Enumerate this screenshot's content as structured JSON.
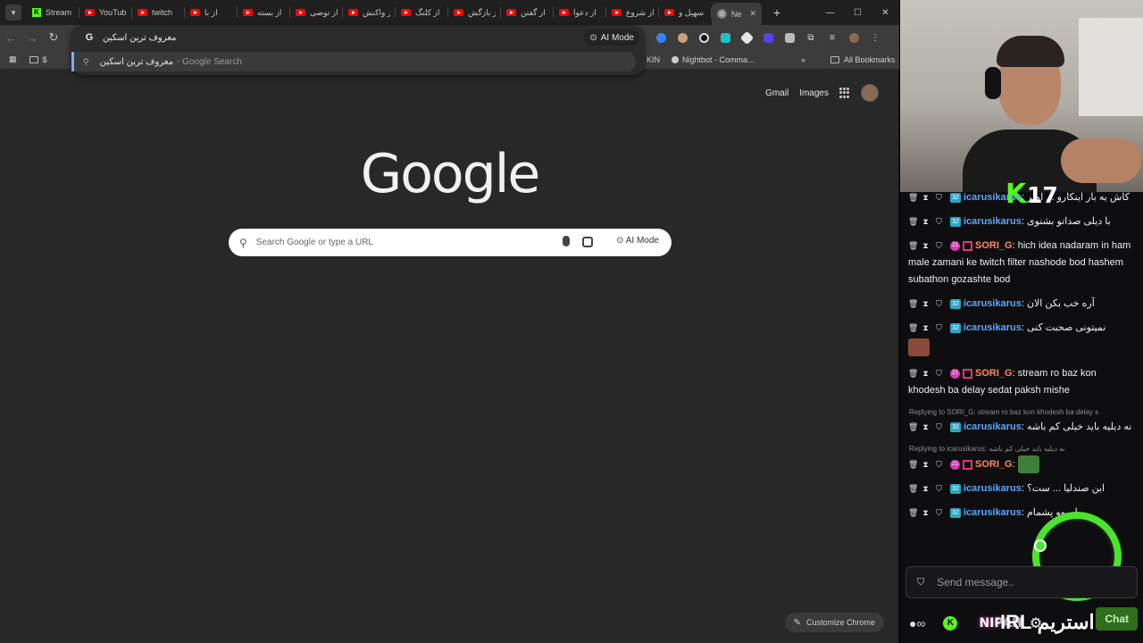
{
  "browser": {
    "tabs": [
      {
        "title": "Stream",
        "favicon": "kick-icon",
        "active": false
      },
      {
        "title": "YouTub",
        "favicon": "youtube-icon",
        "active": false
      },
      {
        "title": "twitch",
        "favicon": "youtube-icon",
        "active": false
      },
      {
        "title": "از با",
        "favicon": "youtube-icon",
        "active": false
      },
      {
        "title": "از بسته",
        "favicon": "youtube-icon",
        "active": false
      },
      {
        "title": "از توضی",
        "favicon": "youtube-icon",
        "active": false
      },
      {
        "title": "از واکنش",
        "favicon": "youtube-icon",
        "active": false
      },
      {
        "title": "از کلنگ",
        "favicon": "youtube-icon",
        "active": false
      },
      {
        "title": "از بازگش",
        "favicon": "youtube-icon",
        "active": false
      },
      {
        "title": "از گفتن",
        "favicon": "youtube-icon",
        "active": false
      },
      {
        "title": "از دعوا",
        "favicon": "youtube-icon",
        "active": false
      },
      {
        "title": "از شروع",
        "favicon": "youtube-icon",
        "active": false
      },
      {
        "title": "سهیل و",
        "favicon": "youtube-icon",
        "active": false
      },
      {
        "title": "Ne",
        "favicon": "chrome-icon",
        "active": true
      }
    ],
    "omnibox": {
      "value": "معروف ترین اسکین",
      "ai_mode_label": "AI Mode",
      "suggestion_text": "معروف ترین اسکین",
      "suggestion_sub": "- Google Search"
    },
    "bookmarks": [
      {
        "label": "$"
      },
      {
        "label": "KIN"
      },
      {
        "label": "Nightbot - Comma..."
      }
    ],
    "bookmarks_overflow": "»",
    "all_bookmarks_label": "All Bookmarks",
    "ntp": {
      "gmail_label": "Gmail",
      "images_label": "Images",
      "logo_text": "Google",
      "search_placeholder": "Search Google or type a URL",
      "ai_mode_label": "AI Mode",
      "customize_label": "Customize Chrome"
    },
    "accent_color": "#7cacf8"
  },
  "stream": {
    "kick_badge_letter": "K",
    "kick_badge_number": "17",
    "chat": [
      {
        "type": "msg",
        "user": "icarusikarus",
        "badges": [
          "32"
        ],
        "text": "کاش یه بار اینکارو ... امیر"
      },
      {
        "type": "msg",
        "user": "icarusikarus",
        "badges": [
          "32"
        ],
        "text": "با دیلی صداتو بشنوی"
      },
      {
        "type": "msg",
        "user": "SORI_G",
        "badges": [
          "21",
          "n"
        ],
        "text": "hich idea nadaram in ham male zamani ke twitch filter nashode bod hashem subathon gozashte bod"
      },
      {
        "type": "msg",
        "user": "icarusikarus",
        "badges": [
          "32"
        ],
        "text": "آره خب بکن الان"
      },
      {
        "type": "msg",
        "user": "icarusikarus",
        "badges": [
          "32"
        ],
        "text": "نمیتونی صحبت کنی"
      },
      {
        "type": "msg",
        "user": "SORI_G",
        "badges": [
          "21",
          "n"
        ],
        "text": "stream ro baz kon khodesh ba delay sedat paksh mishe"
      },
      {
        "type": "reply",
        "text": "Replying to SORI_G: stream ro baz kon khodesh ba delay s"
      },
      {
        "type": "msg",
        "user": "icarusikarus",
        "badges": [
          "32"
        ],
        "text": "نه دیلیه باید خیلی کم باشه"
      },
      {
        "type": "reply",
        "text": "Replying to icarusikarus: نه دیلیه باید خیلی کم باشه"
      },
      {
        "type": "msg",
        "user": "SORI_G",
        "badges": [
          "21",
          "n"
        ],
        "text": ""
      },
      {
        "type": "msg",
        "user": "icarusikarus",
        "badges": [
          "32"
        ],
        "text": "این صندلیا ... ست؟"
      },
      {
        "type": "msg",
        "user": "icarusikarus",
        "badges": [
          "32"
        ],
        "text": "اوروو پشمام"
      }
    ],
    "input_placeholder": "Send message..",
    "chat_button": "Chat",
    "brand_text": "NIPAH",
    "irl_text": "استریم IRL",
    "brand_color": "#53fc18"
  }
}
